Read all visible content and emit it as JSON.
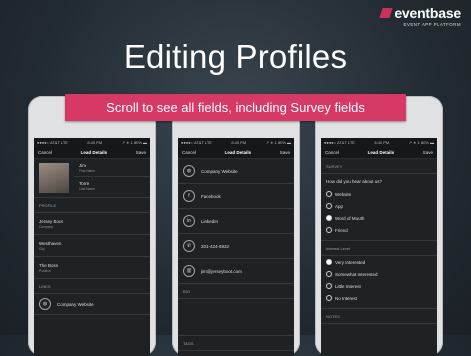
{
  "logo": {
    "name": "eventbase",
    "tagline": "EVENT APP PLATFORM"
  },
  "title": "Editing Profiles",
  "banner": "Scroll to see all fields, including Survey fields",
  "status": {
    "carrier": "●●●●○ AT&T LTE",
    "time": "8:40 PM",
    "battery": "↗ ∗ 1 80% ▬"
  },
  "nav": {
    "cancel": "Cancel",
    "title": "Lead Details",
    "save": "Save"
  },
  "phone1": {
    "first_name": "Jim",
    "first_label": "First Name",
    "last_name": "Torre",
    "last_label": "Last Name",
    "section_profile": "PROFILE",
    "company": "Jersey Boot",
    "company_label": "Company",
    "city": "Westhaven",
    "city_label": "City",
    "position": "The Boss",
    "position_label": "Position",
    "section_links": "LINKS",
    "website": "Company Website"
  },
  "phone2": {
    "website": "Company Website",
    "facebook": "Facebook",
    "linkedin": "LinkedIn",
    "phone": "201-424-6932",
    "email": "jim@jerseyboot.com",
    "bio": "BIO",
    "tags": "TAGS"
  },
  "phone3": {
    "section_survey": "SURVEY",
    "question1": "How did you hear about us?",
    "options1": [
      "Website",
      "App",
      "Word of Mouth",
      "Friend"
    ],
    "selected1": 2,
    "section_interest": "Interest Level",
    "options2": [
      "Very Interested",
      "Somewhat Interested",
      "Little Interest",
      "No Interest"
    ],
    "selected2": 0,
    "section_notes": "NOTES"
  },
  "colors": {
    "accent": "#d73966",
    "background": "#232b32"
  }
}
